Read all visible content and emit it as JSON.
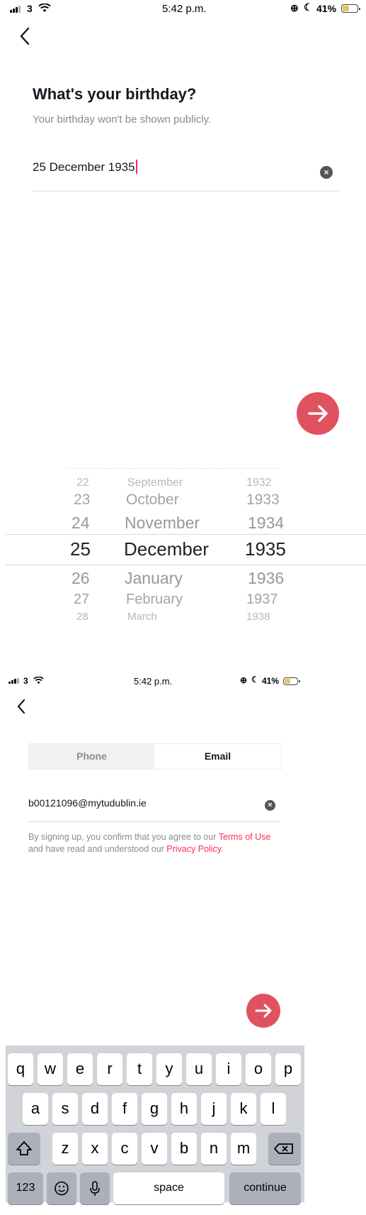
{
  "screen1": {
    "status": {
      "carrier": "3",
      "time": "5:42 p.m.",
      "battery": "41%"
    },
    "title": "What's your birthday?",
    "subtitle": "Your birthday won't be shown publicly.",
    "date_value": "25 December 1935",
    "picker": {
      "rows": [
        {
          "day": "22",
          "month": "September",
          "year": "1932"
        },
        {
          "day": "23",
          "month": "October",
          "year": "1933"
        },
        {
          "day": "24",
          "month": "November",
          "year": "1934"
        },
        {
          "day": "25",
          "month": "December",
          "year": "1935"
        },
        {
          "day": "26",
          "month": "January",
          "year": "1936"
        },
        {
          "day": "27",
          "month": "February",
          "year": "1937"
        },
        {
          "day": "28",
          "month": "March",
          "year": "1938"
        }
      ]
    }
  },
  "screen2": {
    "status": {
      "carrier": "3",
      "time": "5:42 p.m.",
      "battery": "41%"
    },
    "tabs": [
      "Phone",
      "Email"
    ],
    "email_value": "b00121096@mytudublin.ie",
    "terms": {
      "part1": "By signing up, you confirm that you agree to our ",
      "link1": "Terms of Use",
      "part2": " and have read and understood our ",
      "link2": "Privacy Policy",
      "part3": "."
    }
  },
  "keyboard": {
    "row1": [
      "q",
      "w",
      "e",
      "r",
      "t",
      "y",
      "u",
      "i",
      "o",
      "p"
    ],
    "row2": [
      "a",
      "s",
      "d",
      "f",
      "g",
      "h",
      "j",
      "k",
      "l"
    ],
    "row3": [
      "z",
      "x",
      "c",
      "v",
      "b",
      "n",
      "m"
    ],
    "numbers": "123",
    "space": "space",
    "continue": "continue"
  },
  "colors": {
    "accent": "#fe2c55",
    "fab": "#e0525f"
  }
}
